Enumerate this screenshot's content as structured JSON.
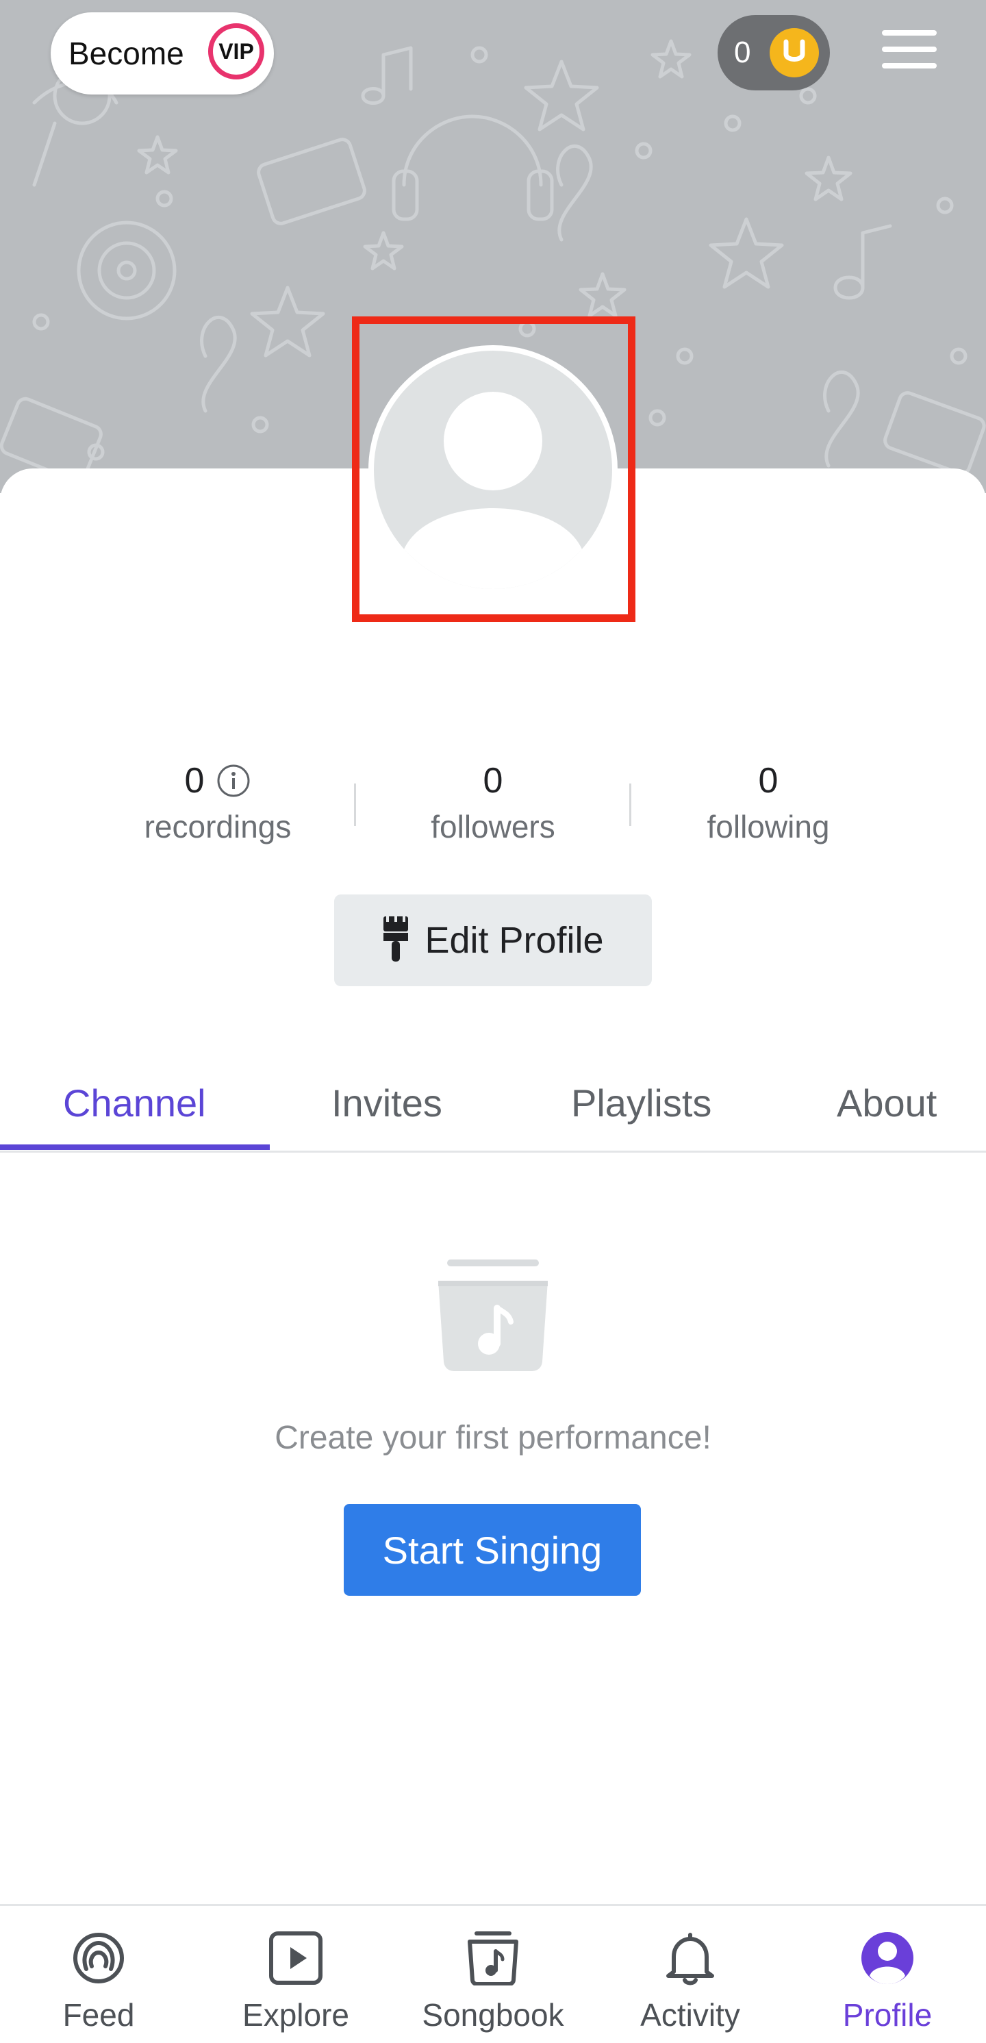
{
  "header": {
    "vip_button": {
      "prefix": "Become",
      "badge": "VIP"
    },
    "coins": {
      "count": "0",
      "icon": "horseshoe-coin-icon"
    },
    "menu_icon": "hamburger-menu-icon"
  },
  "profile": {
    "avatar_icon": "default-avatar-icon"
  },
  "stats": {
    "recordings": {
      "value": "0",
      "label": "recordings",
      "icon": "info-icon"
    },
    "followers": {
      "value": "0",
      "label": "followers"
    },
    "following": {
      "value": "0",
      "label": "following"
    }
  },
  "edit_profile": {
    "label": "Edit Profile",
    "icon": "paintbrush-icon"
  },
  "tabs": [
    {
      "label": "Channel",
      "active": true
    },
    {
      "label": "Invites",
      "active": false
    },
    {
      "label": "Playlists",
      "active": false
    },
    {
      "label": "About",
      "active": false
    }
  ],
  "empty_state": {
    "icon": "music-folder-icon",
    "message": "Create your first performance!",
    "button_label": "Start Singing"
  },
  "bottom_nav": [
    {
      "label": "Feed",
      "icon": "feed-icon",
      "active": false
    },
    {
      "label": "Explore",
      "icon": "play-square-icon",
      "active": false
    },
    {
      "label": "Songbook",
      "icon": "songbook-icon",
      "active": false
    },
    {
      "label": "Activity",
      "icon": "bell-icon",
      "active": false
    },
    {
      "label": "Profile",
      "icon": "profile-icon",
      "active": true
    }
  ],
  "colors": {
    "accent_purple": "#5b45d6",
    "primary_blue": "#2f7de8",
    "vip_pink": "#e8336d",
    "coin_gold": "#f5b61c",
    "highlight_red": "#ee2a17"
  }
}
